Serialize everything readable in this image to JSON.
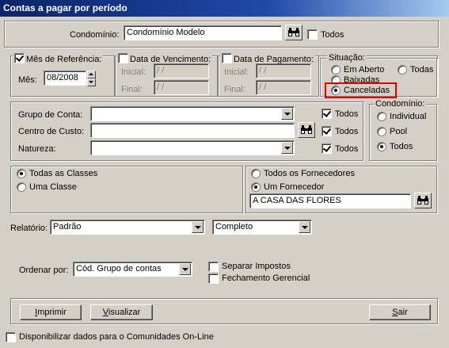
{
  "window": {
    "title": "Contas a pagar por período"
  },
  "condominio": {
    "label": "Condomínio:",
    "value": "Condomínio Modelo",
    "todos_label": "Todos"
  },
  "mes_referencia": {
    "label": "Mês de Referência:",
    "mes_label": "Mês:",
    "mes_value": "08/2008",
    "checked": true
  },
  "data_vencimento": {
    "label": "Data de Vencimento:",
    "inicial_label": "Inicial:",
    "final_label": "Final:",
    "inicial_value": " / /",
    "final_value": " / /"
  },
  "data_pagamento": {
    "label": "Data de Pagamento:",
    "inicial_label": "Inicial:",
    "final_label": "Final:",
    "inicial_value": " / /",
    "final_value": " / /"
  },
  "situacao": {
    "label": "Situação:",
    "options": [
      "Em Aberto",
      "Todas",
      "Baixadas",
      "Canceladas"
    ],
    "selected": "Canceladas",
    "highlight_color": "#e00000"
  },
  "filtros": {
    "grupo_label": "Grupo de Conta:",
    "centro_label": "Centro de Custo:",
    "natureza_label": "Natureza:",
    "todos_label": "Todos"
  },
  "condominio_tipo": {
    "label": "Condomínio:",
    "options": [
      "Individual",
      "Pool",
      "Todos"
    ],
    "selected": "Todos"
  },
  "classes": {
    "options": [
      "Todas as Classes",
      "Uma Classe"
    ],
    "selected": "Todas as Classes"
  },
  "fornecedores": {
    "options": [
      "Todos os Fornecedores",
      "Um Fornecedor"
    ],
    "selected": "Um Fornecedor",
    "value": "A CASA DAS FLORES"
  },
  "relatorio": {
    "label": "Relatório:",
    "tipo_value": "Padrão",
    "modo_value": "Completo"
  },
  "ordenar": {
    "label": "Ordenar por:",
    "value": "Cód. Grupo de contas"
  },
  "opcoes": {
    "separar_impostos": "Separar Impostos",
    "fechamento_gerencial": "Fechamento Gerencial"
  },
  "buttons": {
    "imprimir_u": "I",
    "imprimir_rest": "mprimir",
    "visualizar_u": "V",
    "visualizar_rest": "isualizar",
    "sair_u": "S",
    "sair_rest": "air"
  },
  "footer": {
    "online_label": "Disponibilizar dados para o Comunidades On-Line"
  },
  "icons": {
    "search": "binoculars-icon"
  },
  "colors": {
    "titlebar": "#0a246a",
    "face": "#d4d0c8"
  }
}
